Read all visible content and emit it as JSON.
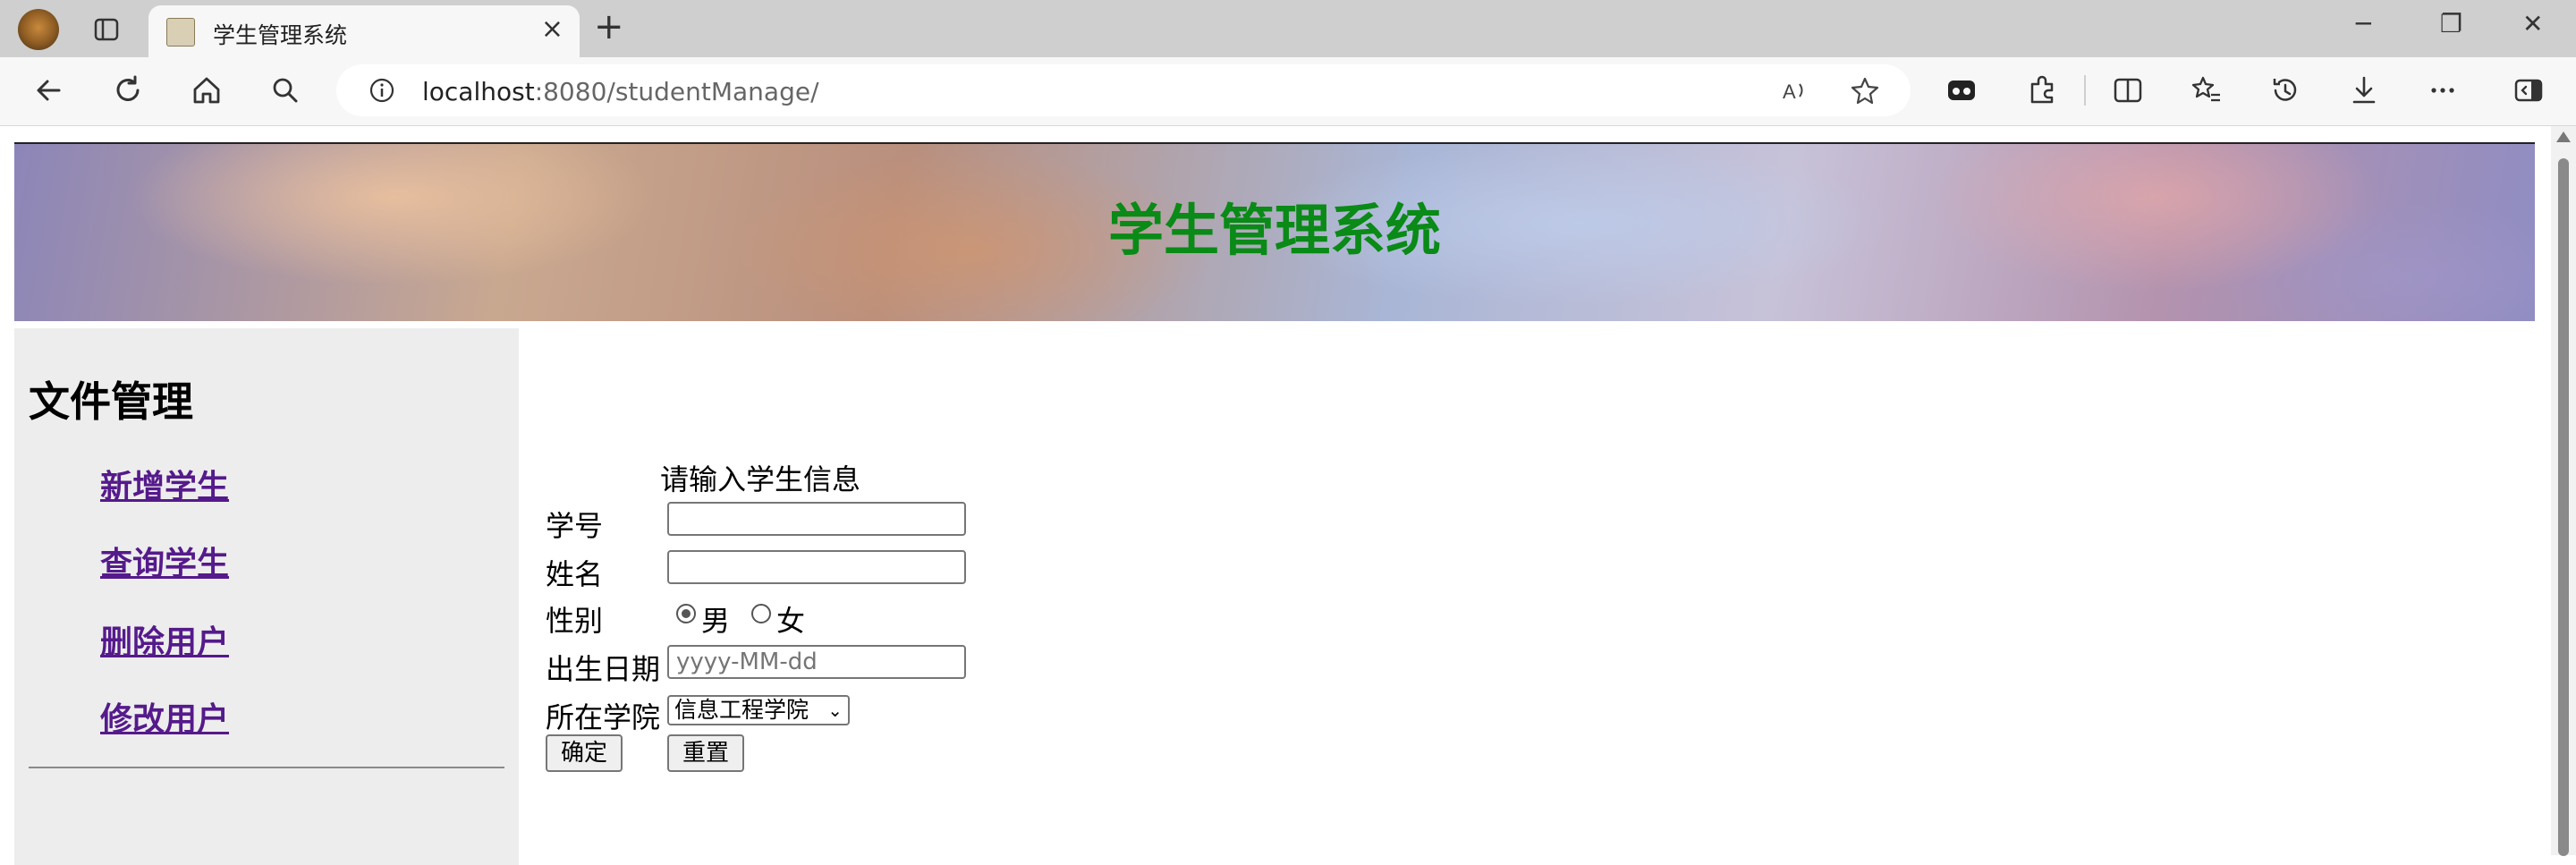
{
  "browser": {
    "tab_title": "学生管理系统",
    "new_tab_symbol": "+",
    "tab_close_symbol": "×",
    "address_host": "localhost",
    "address_rest": ":8080/studentManage/",
    "window_controls": {
      "minimize": "─",
      "restore": "❐",
      "close": "✕"
    }
  },
  "banner": {
    "title": "学生管理系统",
    "title_color": "#0a8a16"
  },
  "sidebar": {
    "heading": "文件管理",
    "links": [
      {
        "label": "新增学生"
      },
      {
        "label": "查询学生"
      },
      {
        "label": "删除用户"
      },
      {
        "label": "修改用户"
      }
    ],
    "link_color": "#551a8b"
  },
  "form": {
    "caption": "请输入学生信息",
    "student_id_label": "学号",
    "student_id_value": "",
    "name_label": "姓名",
    "name_value": "",
    "gender_label": "性别",
    "gender_options": [
      "男",
      "女"
    ],
    "gender_selected": "男",
    "birth_label": "出生日期",
    "birth_placeholder": "yyyy-MM-dd",
    "college_label": "所在学院",
    "college_selected": "信息工程学院",
    "submit_label": "确定",
    "reset_label": "重置"
  }
}
